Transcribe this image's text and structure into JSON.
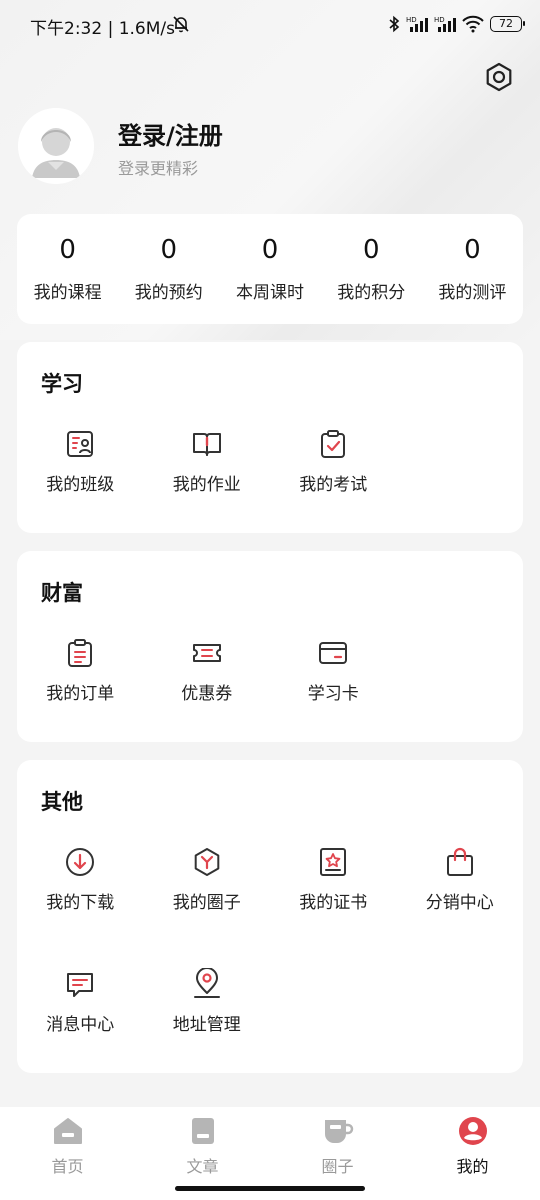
{
  "status_bar": {
    "time_speed": "下午2:32 | 1.6M/s",
    "signal1": "HD",
    "signal2": "HD",
    "battery": "72"
  },
  "profile": {
    "title": "登录/注册",
    "subtitle": "登录更精彩"
  },
  "stats": [
    {
      "value": "0",
      "label": "我的课程"
    },
    {
      "value": "0",
      "label": "我的预约"
    },
    {
      "value": "0",
      "label": "本周课时"
    },
    {
      "value": "0",
      "label": "我的积分"
    },
    {
      "value": "0",
      "label": "我的测评"
    }
  ],
  "sections": {
    "study": {
      "title": "学习",
      "items": [
        {
          "label": "我的班级",
          "icon": "class-icon"
        },
        {
          "label": "我的作业",
          "icon": "homework-icon"
        },
        {
          "label": "我的考试",
          "icon": "exam-icon"
        }
      ]
    },
    "wealth": {
      "title": "财富",
      "items": [
        {
          "label": "我的订单",
          "icon": "order-icon"
        },
        {
          "label": "优惠券",
          "icon": "coupon-icon"
        },
        {
          "label": "学习卡",
          "icon": "study-card-icon"
        }
      ]
    },
    "other": {
      "title": "其他",
      "items": [
        {
          "label": "我的下载",
          "icon": "download-icon"
        },
        {
          "label": "我的圈子",
          "icon": "circle-icon"
        },
        {
          "label": "我的证书",
          "icon": "certificate-icon"
        },
        {
          "label": "分销中心",
          "icon": "distribution-icon"
        },
        {
          "label": "消息中心",
          "icon": "message-icon"
        },
        {
          "label": "地址管理",
          "icon": "location-icon"
        }
      ]
    }
  },
  "tabbar": [
    {
      "label": "首页",
      "icon": "home-icon",
      "active": false
    },
    {
      "label": "文章",
      "icon": "article-icon",
      "active": false
    },
    {
      "label": "圈子",
      "icon": "cup-icon",
      "active": false
    },
    {
      "label": "我的",
      "icon": "profile-icon",
      "active": true
    }
  ],
  "colors": {
    "accent": "#e0454d",
    "icon_dark": "#333333",
    "inactive": "#9a9a9a"
  }
}
